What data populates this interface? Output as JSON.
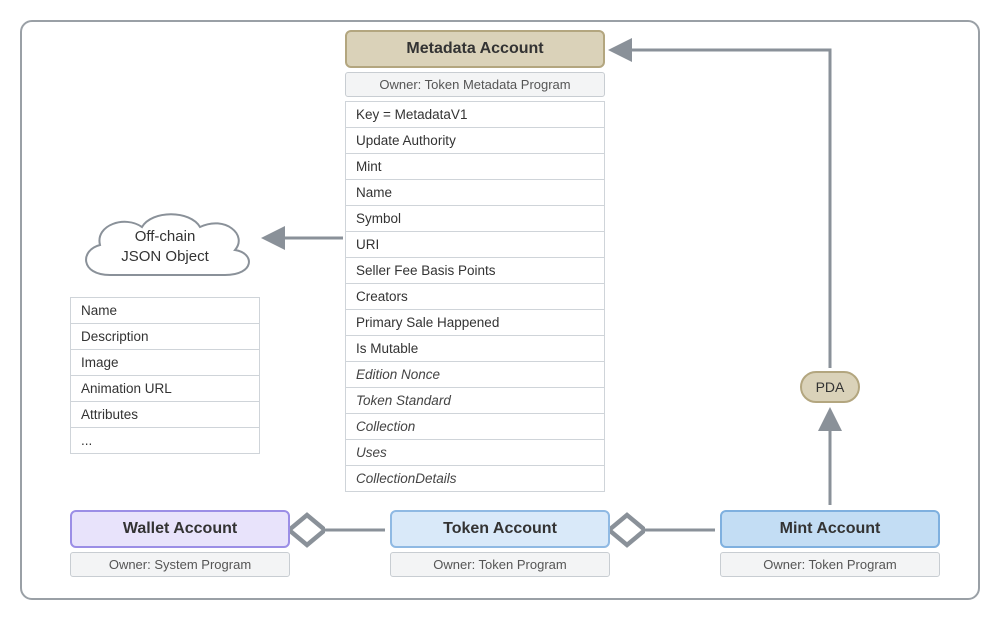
{
  "metadata": {
    "title": "Metadata Account",
    "owner": "Owner: Token Metadata Program",
    "fields": [
      {
        "text": "Key = MetadataV1",
        "italic": false
      },
      {
        "text": "Update Authority",
        "italic": false
      },
      {
        "text": "Mint",
        "italic": false
      },
      {
        "text": "Name",
        "italic": false
      },
      {
        "text": "Symbol",
        "italic": false
      },
      {
        "text": "URI",
        "italic": false
      },
      {
        "text": "Seller Fee Basis Points",
        "italic": false
      },
      {
        "text": "Creators",
        "italic": false
      },
      {
        "text": "Primary Sale Happened",
        "italic": false
      },
      {
        "text": "Is Mutable",
        "italic": false
      },
      {
        "text": "Edition Nonce",
        "italic": true
      },
      {
        "text": "Token Standard",
        "italic": true
      },
      {
        "text": "Collection",
        "italic": true
      },
      {
        "text": "Uses",
        "italic": true
      },
      {
        "text": "CollectionDetails",
        "italic": true
      }
    ]
  },
  "json_object": {
    "title_line1": "Off-chain",
    "title_line2": "JSON Object",
    "fields": [
      "Name",
      "Description",
      "Image",
      "Animation URL",
      "Attributes",
      "..."
    ]
  },
  "wallet": {
    "title": "Wallet Account",
    "owner": "Owner: System Program"
  },
  "token": {
    "title": "Token Account",
    "owner": "Owner: Token Program"
  },
  "mint": {
    "title": "Mint Account",
    "owner": "Owner: Token Program"
  },
  "pda": {
    "label": "PDA"
  }
}
